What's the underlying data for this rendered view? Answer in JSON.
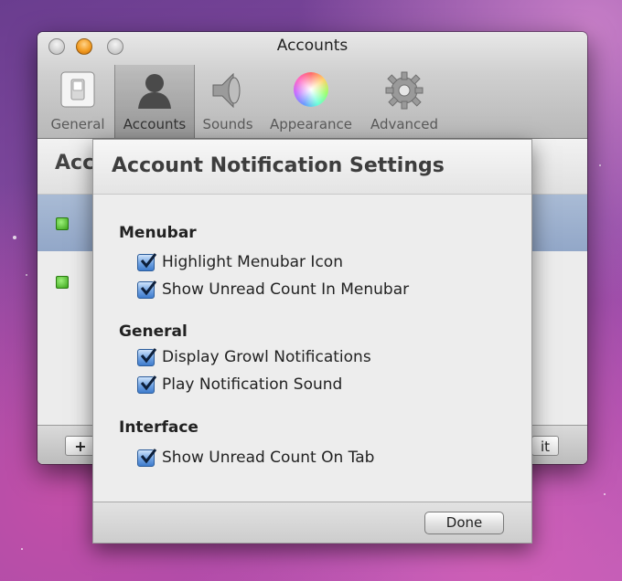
{
  "window": {
    "title": "Accounts",
    "toolbar": [
      {
        "label": "General",
        "icon": "light-switch-icon"
      },
      {
        "label": "Accounts",
        "icon": "person-silhouette-icon",
        "selected": true
      },
      {
        "label": "Sounds",
        "icon": "speaker-icon"
      },
      {
        "label": "Appearance",
        "icon": "color-wheel-icon"
      },
      {
        "label": "Advanced",
        "icon": "gear-icon"
      }
    ],
    "accounts_header_partial": "Acc",
    "bottom": {
      "add_label": "+",
      "edit_partial": "Edit"
    }
  },
  "sheet": {
    "title": "Account Notification Settings",
    "sections": [
      {
        "title": "Menubar",
        "options": [
          {
            "label": "Highlight Menubar Icon",
            "checked": true
          },
          {
            "label": "Show Unread Count In Menubar",
            "checked": true
          }
        ]
      },
      {
        "title": "General",
        "options": [
          {
            "label": "Display Growl Notifications",
            "checked": true
          },
          {
            "label": "Play Notification Sound",
            "checked": true
          }
        ]
      },
      {
        "title": "Interface",
        "options": [
          {
            "label": "Show Unread Count On Tab",
            "checked": true
          }
        ]
      }
    ],
    "done_label": "Done"
  },
  "colors": {
    "checkbox_blue": "#3f7ccc",
    "selected_row": "#92a7c8",
    "status_green": "#3aa51a"
  }
}
